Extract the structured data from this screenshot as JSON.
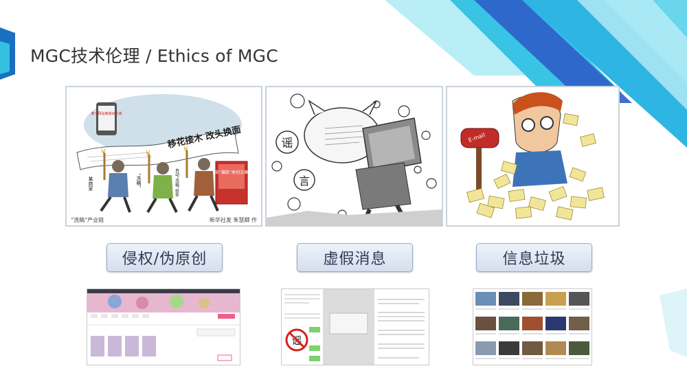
{
  "slide": {
    "title": "MGC技术伦理 / Ethics of MGC",
    "colors": {
      "accent_blue": "#1b6fc0",
      "accent_cyan": "#37c6e6",
      "light_cyan": "#8fe4f0"
    }
  },
  "panels": [
    {
      "name": "plagiarism-cartoon",
      "phone_text": "某个网站被爆出抄袭",
      "banner_text": "移花接木 改头换面",
      "figure_label_1": "某商家",
      "figure_label_2": "“洗稿”",
      "figure_label_3": "自动“洗稿”软件",
      "book_text": "采“爆款”原创文章",
      "caption_left": "“洗稿”产业链",
      "caption_right": "新华社发 朱慧卿 作"
    },
    {
      "name": "rumor-cartoon",
      "bubble_1": "谣",
      "bubble_2": "言"
    },
    {
      "name": "spam-cartoon",
      "mailbox_text": "E-mail"
    }
  ],
  "labels": [
    {
      "text": "侵权/伪原创"
    },
    {
      "text": "虚假消息"
    },
    {
      "text": "信息垃圾"
    }
  ],
  "screenshots": [
    {
      "name": "video-site-screenshot"
    },
    {
      "name": "rumor-chat-screenshot",
      "stamp": "谣"
    },
    {
      "name": "image-grid-screenshot"
    }
  ]
}
